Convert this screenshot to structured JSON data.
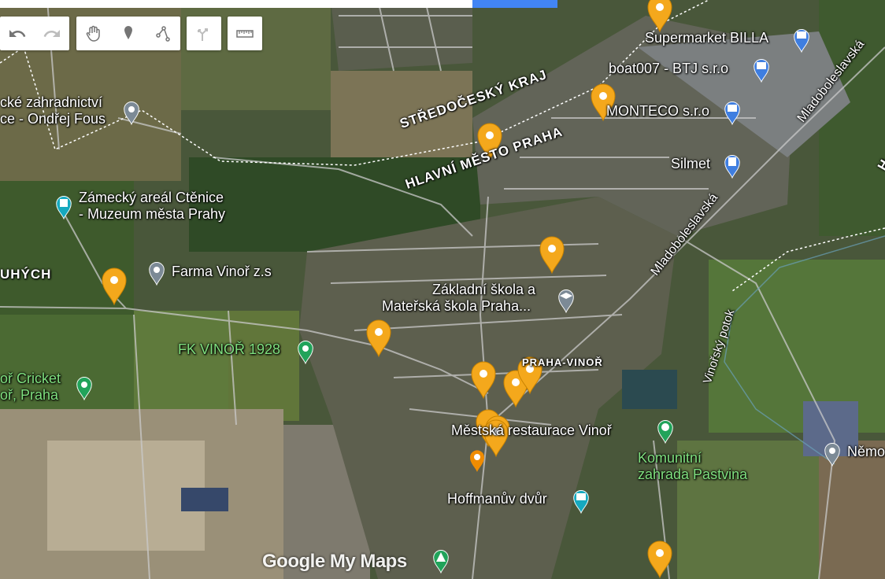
{
  "toolbar": {
    "undo": "undo-icon",
    "redo": "redo-icon",
    "hand": "hand-icon",
    "marker": "marker-icon",
    "line": "draw-line-icon",
    "directions": "directions-icon",
    "ruler": "ruler-icon"
  },
  "labels": {
    "garden_shop_1": "cké zahradnictví",
    "garden_shop_2": "ce - Ondřej Fous",
    "zamecky_1": "Zámecký areál Ctěnice",
    "zamecky_2": "- Muzeum města Prahy",
    "farma": "Farma Vinoř z.s",
    "uhych": "UHÝCH",
    "fk_vinor": "FK VINOŘ 1928",
    "cricket_1": "oř Cricket",
    "cricket_2": "oř, Praha",
    "supermarket": "Supermarket BILLA",
    "boat": "boat007 - BTJ s.r.o",
    "monteco": "MONTECO s.r.o",
    "silmet": "Silmet",
    "stredocesky": "STŘEDOČESKÝ KRAJ",
    "hlavni": "HLAVNÍ MĚSTO PRAHA",
    "mladoboleslavska": "Mladoboleslavská",
    "skola_1": "Základní škola a",
    "skola_2": "Mateřská škola Praha...",
    "praha_vinor": "PRAHA-VINOŘ",
    "restaurace": "Městská restaurace Vinoř",
    "vinorsky": "Vinořský potok",
    "komunitni_1": "Komunitní",
    "komunitni_2": "zahrada Pastvina",
    "hoffman": "Hoffmanův dvůr",
    "nemo": "Němo",
    "edge_h": "H"
  },
  "brand": "Google My Maps",
  "colors": {
    "pin_orange": "#f4a81c",
    "pin_grey": "#7c8a96",
    "pin_green": "#21a35a",
    "pin_teal": "#16a9bf",
    "pin_blue": "#3f7ee0",
    "road": "#c9c9c9",
    "brand_blue": "#4285f4"
  }
}
